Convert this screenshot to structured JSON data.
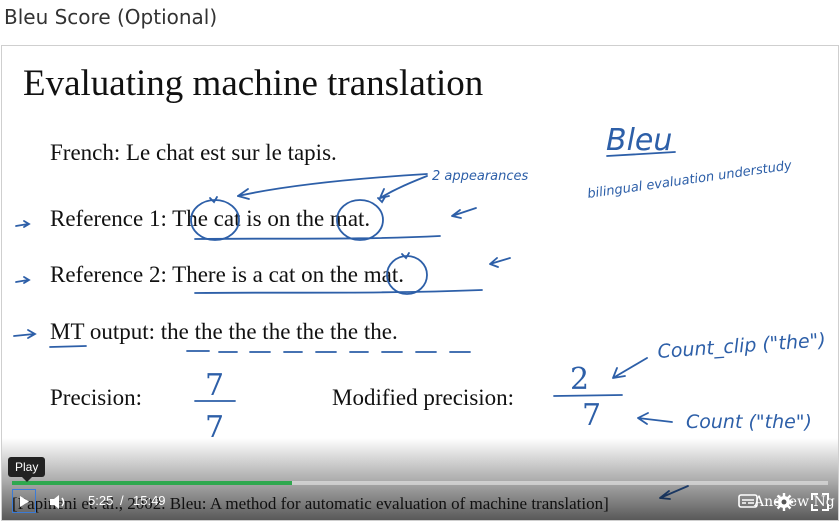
{
  "page_title": "Bleu Score (Optional)",
  "slide": {
    "title": "Evaluating machine translation",
    "french": "French: Le chat est sur le tapis.",
    "ref1": "Reference 1: The cat is on the mat.",
    "ref2": "Reference 2: There is a cat on the mat.",
    "mt_output": "MT output: the the the the the the the.",
    "precision_label": "Precision:",
    "precision_num": "7",
    "precision_den": "7",
    "modified_label": "Modified precision:",
    "modified_num": "2",
    "modified_den": "7",
    "citation": "[Papineni et. al., 2002. Bleu: A method for automatic evaluation of machine translation]",
    "handwriting": {
      "bleu": "Bleu",
      "bilingual": "bilingual evaluation understudy",
      "appearances": "2 appearances",
      "count_clip": "Count_clip (\"the\")",
      "count": "Count (\"the\")"
    }
  },
  "player": {
    "tooltip": "Play",
    "current_time": "5:25",
    "separator": "/",
    "duration": "15:49",
    "progress": 0.343,
    "accent_color": "#2fa84f",
    "icons": [
      "play-icon",
      "volume-icon",
      "captions-icon",
      "settings-icon",
      "fullscreen-icon"
    ]
  },
  "overlay_name_fragment": "Andrew Ng"
}
